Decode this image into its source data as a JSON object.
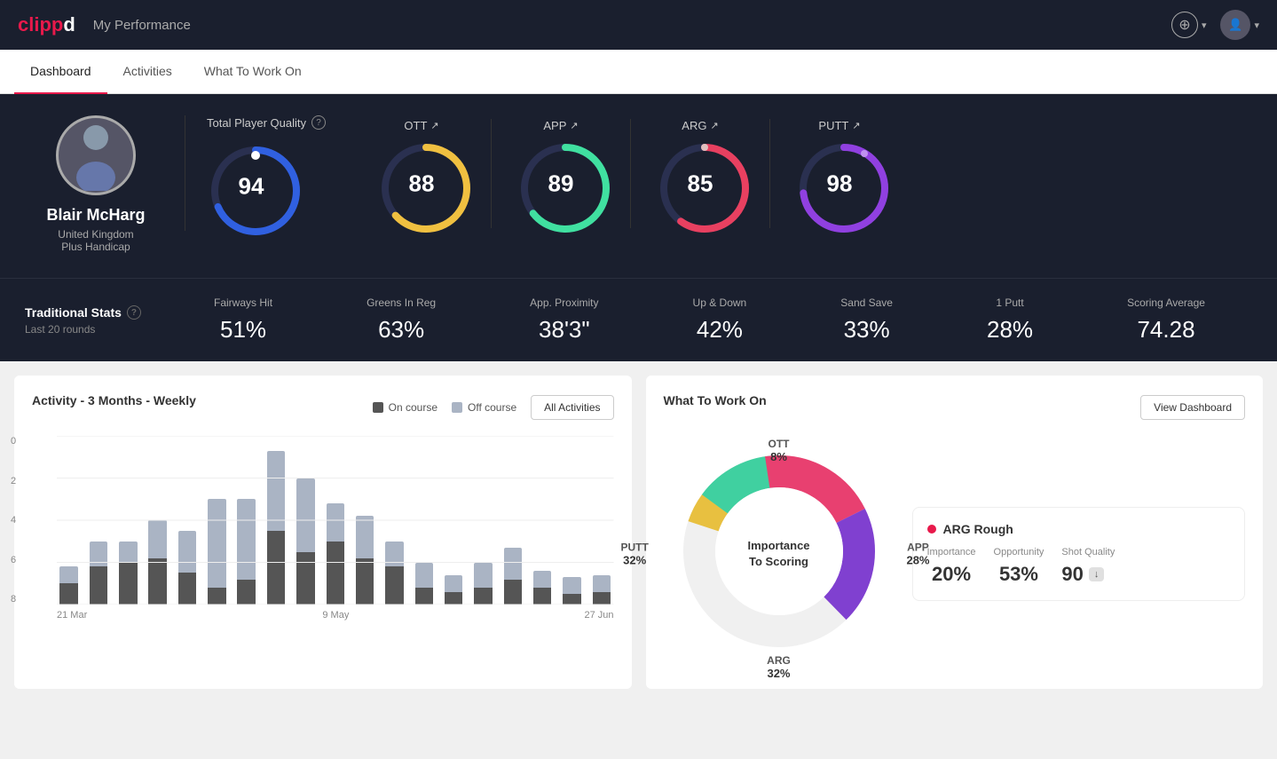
{
  "header": {
    "logo": "clippd",
    "title": "My Performance",
    "add_btn_label": "+",
    "dropdown_label": "▾"
  },
  "tabs": [
    {
      "label": "Dashboard",
      "active": true
    },
    {
      "label": "Activities",
      "active": false
    },
    {
      "label": "What To Work On",
      "active": false
    }
  ],
  "hero": {
    "player": {
      "name": "Blair McHarg",
      "country": "United Kingdom",
      "handicap": "Plus Handicap"
    },
    "tpq": {
      "label": "Total Player Quality",
      "value": 94
    },
    "scores": [
      {
        "label": "OTT",
        "value": 88,
        "color_start": "#f0c040",
        "color_end": "#e0a020"
      },
      {
        "label": "APP",
        "value": 89,
        "color_start": "#40e0a0",
        "color_end": "#20c080"
      },
      {
        "label": "ARG",
        "value": 85,
        "color_start": "#e84040",
        "color_end": "#c02060"
      },
      {
        "label": "PUTT",
        "value": 98,
        "color_start": "#9040e0",
        "color_end": "#7020c0"
      }
    ]
  },
  "trad_stats": {
    "section_label": "Traditional Stats",
    "sub_label": "Last 20 rounds",
    "items": [
      {
        "label": "Fairways Hit",
        "value": "51%"
      },
      {
        "label": "Greens In Reg",
        "value": "63%"
      },
      {
        "label": "App. Proximity",
        "value": "38'3\""
      },
      {
        "label": "Up & Down",
        "value": "42%"
      },
      {
        "label": "Sand Save",
        "value": "33%"
      },
      {
        "label": "1 Putt",
        "value": "28%"
      },
      {
        "label": "Scoring Average",
        "value": "74.28"
      }
    ]
  },
  "activity_chart": {
    "title": "Activity - 3 Months - Weekly",
    "legend": [
      {
        "label": "On course",
        "color": "#555"
      },
      {
        "label": "Off course",
        "color": "#aab4c4"
      }
    ],
    "btn_label": "All Activities",
    "y_labels": [
      "0",
      "2",
      "4",
      "6",
      "8"
    ],
    "x_labels": [
      "21 Mar",
      "9 May",
      "27 Jun"
    ],
    "bars": [
      {
        "on": 10,
        "off": 8
      },
      {
        "on": 18,
        "off": 12
      },
      {
        "on": 20,
        "off": 10
      },
      {
        "on": 22,
        "off": 18
      },
      {
        "on": 15,
        "off": 20
      },
      {
        "on": 8,
        "off": 42
      },
      {
        "on": 12,
        "off": 38
      },
      {
        "on": 35,
        "off": 38
      },
      {
        "on": 25,
        "off": 35
      },
      {
        "on": 30,
        "off": 18
      },
      {
        "on": 22,
        "off": 20
      },
      {
        "on": 18,
        "off": 12
      },
      {
        "on": 8,
        "off": 12
      },
      {
        "on": 6,
        "off": 8
      },
      {
        "on": 8,
        "off": 12
      },
      {
        "on": 12,
        "off": 15
      },
      {
        "on": 8,
        "off": 8
      },
      {
        "on": 5,
        "off": 8
      },
      {
        "on": 6,
        "off": 8
      }
    ],
    "max_val": 80
  },
  "what_to_work_on": {
    "title": "What To Work On",
    "btn_label": "View Dashboard",
    "donut_center_line1": "Importance",
    "donut_center_line2": "To Scoring",
    "segments": [
      {
        "label": "OTT",
        "pct": "8%",
        "color": "#e8c040",
        "angle_start": 0,
        "angle_end": 29
      },
      {
        "label": "APP",
        "pct": "28%",
        "color": "#40d0a0",
        "angle_start": 29,
        "angle_end": 130
      },
      {
        "label": "ARG",
        "pct": "32%",
        "color": "#e84070",
        "angle_start": 130,
        "angle_end": 245
      },
      {
        "label": "PUTT",
        "pct": "32%",
        "color": "#8040d0",
        "angle_start": 245,
        "angle_end": 360
      }
    ],
    "insight": {
      "title": "ARG Rough",
      "dot_color": "#e8194b",
      "cols": [
        {
          "label": "Importance",
          "value": "20%"
        },
        {
          "label": "Opportunity",
          "value": "53%"
        },
        {
          "label": "Shot Quality",
          "value": "90",
          "badge": true
        }
      ]
    }
  }
}
